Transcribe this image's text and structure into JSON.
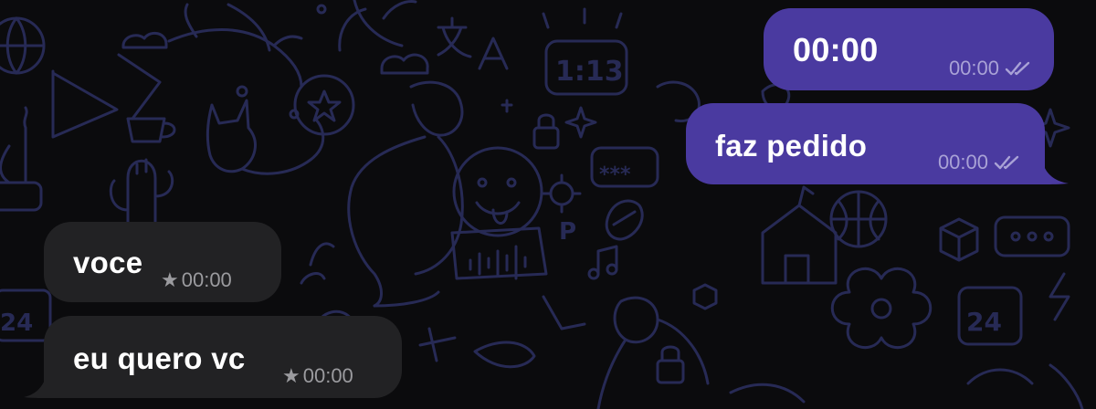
{
  "theme": {
    "background": "#0b0b0d",
    "wallpaper_line": "#272a55",
    "outgoing_bubble": "#4a3aa0",
    "incoming_bubble": "#222224",
    "text": "#ffffff",
    "outgoing_meta": "#a9a2d6",
    "incoming_meta": "#9b9b9f"
  },
  "wallpaper": {
    "doodle_texts": [
      "1:13",
      "***",
      "24",
      "24",
      "P"
    ]
  },
  "messages": [
    {
      "direction": "outgoing",
      "text": "00:00",
      "time": "00:00",
      "status_icon": "double-check-read-icon"
    },
    {
      "direction": "outgoing",
      "text": "faz pedido",
      "time": "00:00",
      "status_icon": "double-check-read-icon"
    },
    {
      "direction": "incoming",
      "text": "voce",
      "time": "00:00",
      "starred": true,
      "star_icon": "star-icon"
    },
    {
      "direction": "incoming",
      "text": "eu quero vc",
      "time": "00:00",
      "starred": true,
      "star_icon": "star-icon"
    }
  ]
}
